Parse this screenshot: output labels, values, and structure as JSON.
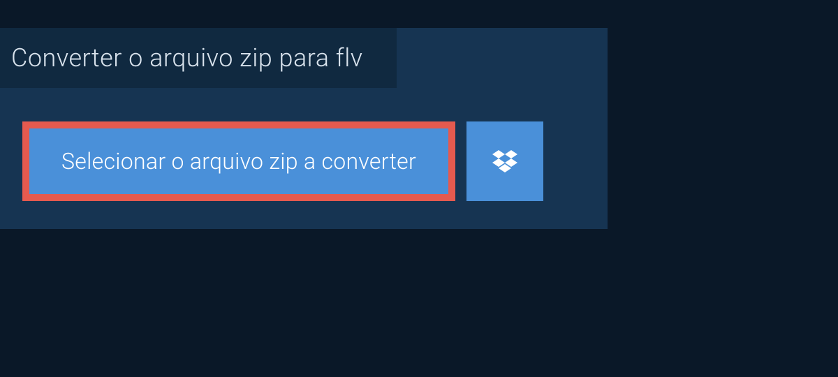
{
  "page": {
    "title": "Converter o arquivo zip para flv"
  },
  "actions": {
    "select_file_label": "Selecionar o arquivo zip a converter"
  },
  "colors": {
    "background_outer": "#0a1828",
    "background_panel": "#163452",
    "background_title": "#102940",
    "button_primary": "#4a90d9",
    "button_highlight_border": "#e55a4f",
    "text_light": "#d8e2ec",
    "text_white": "#ffffff"
  }
}
